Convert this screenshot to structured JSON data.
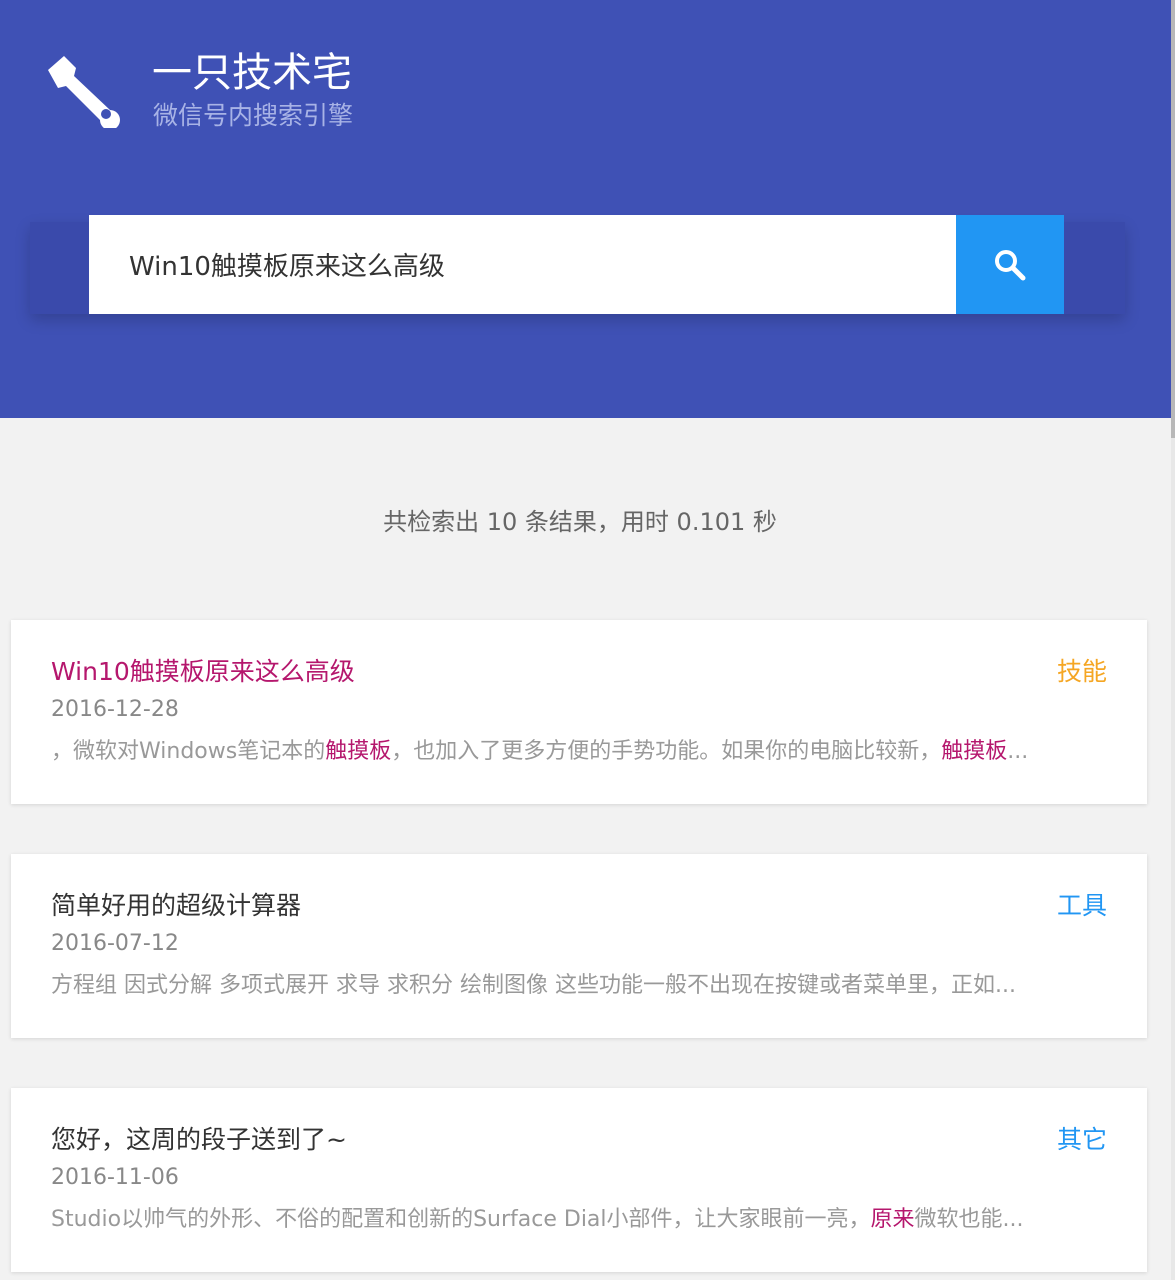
{
  "header": {
    "title": "一只技术宅",
    "subtitle": "微信号内搜索引擎",
    "logo_icon": "wrench-icon",
    "background": "#3f51b5"
  },
  "search": {
    "query": "Win10触摸板原来这么高级",
    "button_icon": "search-icon",
    "button_color": "#2196f3"
  },
  "summary": {
    "prefix": "共检索出",
    "count": "10",
    "middle": "条结果，用时",
    "time": "0.101",
    "suffix": "秒"
  },
  "results": [
    {
      "title": "Win10触摸板原来这么高级",
      "title_highlighted": true,
      "tag": "技能",
      "tag_color": "#f5a623",
      "date": "2016-12-28",
      "snippet_parts": [
        {
          "text": "，微软对Windows笔记本的",
          "kw": false
        },
        {
          "text": "触摸板",
          "kw": true
        },
        {
          "text": "，也加入了更多方便的手势功能。如果你的电脑比较新，",
          "kw": false
        },
        {
          "text": "触摸板",
          "kw": true
        },
        {
          "text": "...",
          "kw": false
        }
      ]
    },
    {
      "title": "简单好用的超级计算器",
      "title_highlighted": false,
      "tag": "工具",
      "tag_color": "#2196f3",
      "date": "2016-07-12",
      "snippet_parts": [
        {
          "text": "方程组 因式分解 多项式展开 求导 求积分 绘制图像 这些功能一般不出现在按键或者菜单里，正如...",
          "kw": false
        }
      ]
    },
    {
      "title": "您好，这周的段子送到了~",
      "title_highlighted": false,
      "tag": "其它",
      "tag_color": "#2196f3",
      "date": "2016-11-06",
      "snippet_parts": [
        {
          "text": "Studio以帅气的外形、不俗的配置和创新的Surface Dial小部件，让大家眼前一亮，",
          "kw": false
        },
        {
          "text": "原来",
          "kw": true
        },
        {
          "text": "微软也能...",
          "kw": false
        }
      ]
    }
  ]
}
